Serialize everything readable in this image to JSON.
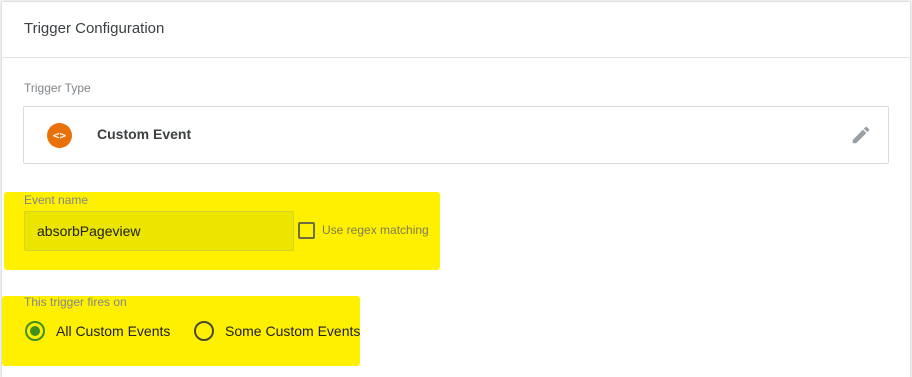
{
  "card": {
    "title": "Trigger Configuration"
  },
  "trigger_type": {
    "label": "Trigger Type",
    "selected_name": "Custom Event",
    "icon": "code-brackets-icon",
    "icon_glyph": "<>",
    "icon_color": "#e8710a",
    "edit_icon": "pencil-icon"
  },
  "event_name": {
    "label": "Event name",
    "value": "absorbPageview",
    "regex_checkbox_label": "Use regex matching",
    "regex_checked": false
  },
  "fires_on": {
    "label": "This trigger fires on",
    "options": [
      {
        "label": "All Custom Events",
        "selected": true
      },
      {
        "label": "Some Custom Events",
        "selected": false
      }
    ]
  },
  "colors": {
    "highlight": "#fff000",
    "radio_selected": "#3f8f1f"
  }
}
